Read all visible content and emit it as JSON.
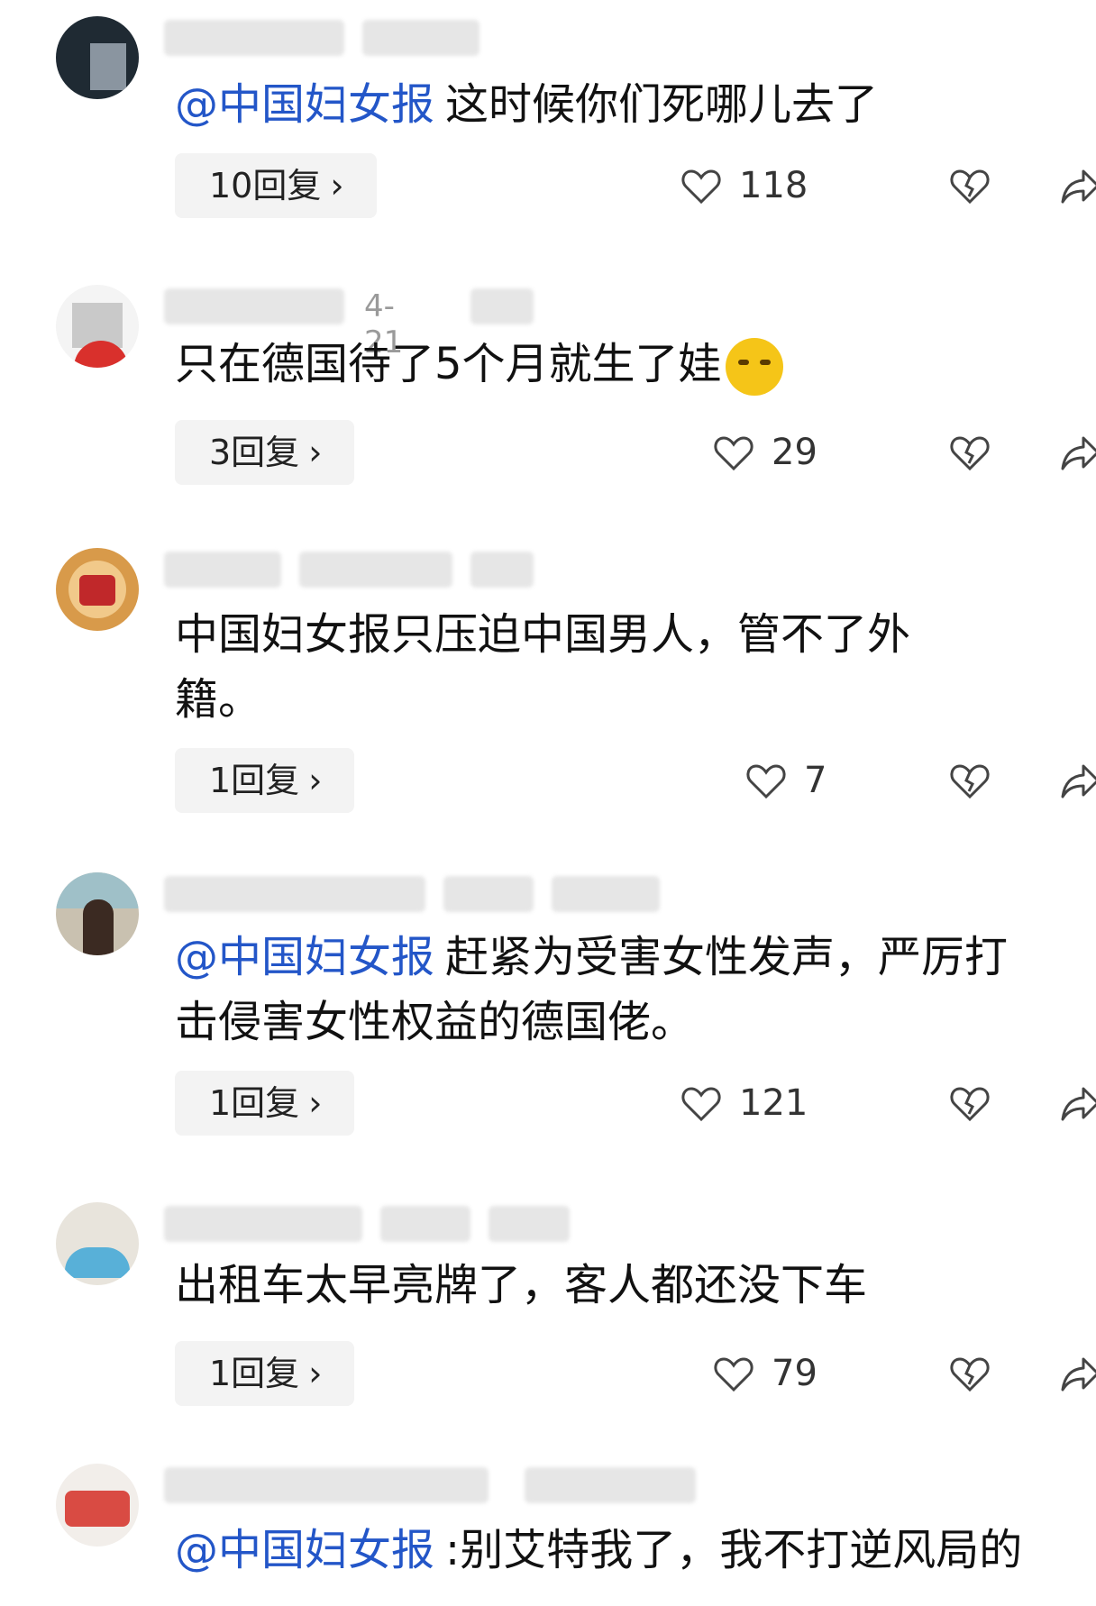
{
  "comments": [
    {
      "meta_visible": "",
      "mention": "@中国妇女报",
      "text": "这时候你们死哪儿去了",
      "replies_label": "10回复",
      "likes": "118"
    },
    {
      "meta_visible": "4-21",
      "mention": "",
      "text": "只在德国待了5个月就生了娃",
      "replies_label": "3回复",
      "likes": "29"
    },
    {
      "meta_visible": "",
      "mention": "",
      "text": "中国妇女报只压迫中国男人，管不了外籍。",
      "replies_label": "1回复",
      "likes": "7"
    },
    {
      "meta_visible": "",
      "mention": "@中国妇女报",
      "text": "赶紧为受害女性发声，严厉打击侵害女性权益的德国佬。",
      "replies_label": "1回复",
      "likes": "121"
    },
    {
      "meta_visible": "",
      "mention": "",
      "text": "出租车太早亮牌了，客人都还没下车",
      "replies_label": "1回复",
      "likes": "79"
    },
    {
      "meta_visible": "",
      "mention": "@中国妇女报",
      "text": ":别艾特我了，我不打逆风局的",
      "replies_label": "",
      "likes": ""
    }
  ],
  "chevron": "›",
  "colors": {
    "mention": "#2356c8",
    "pill_bg": "#f3f3f3"
  }
}
